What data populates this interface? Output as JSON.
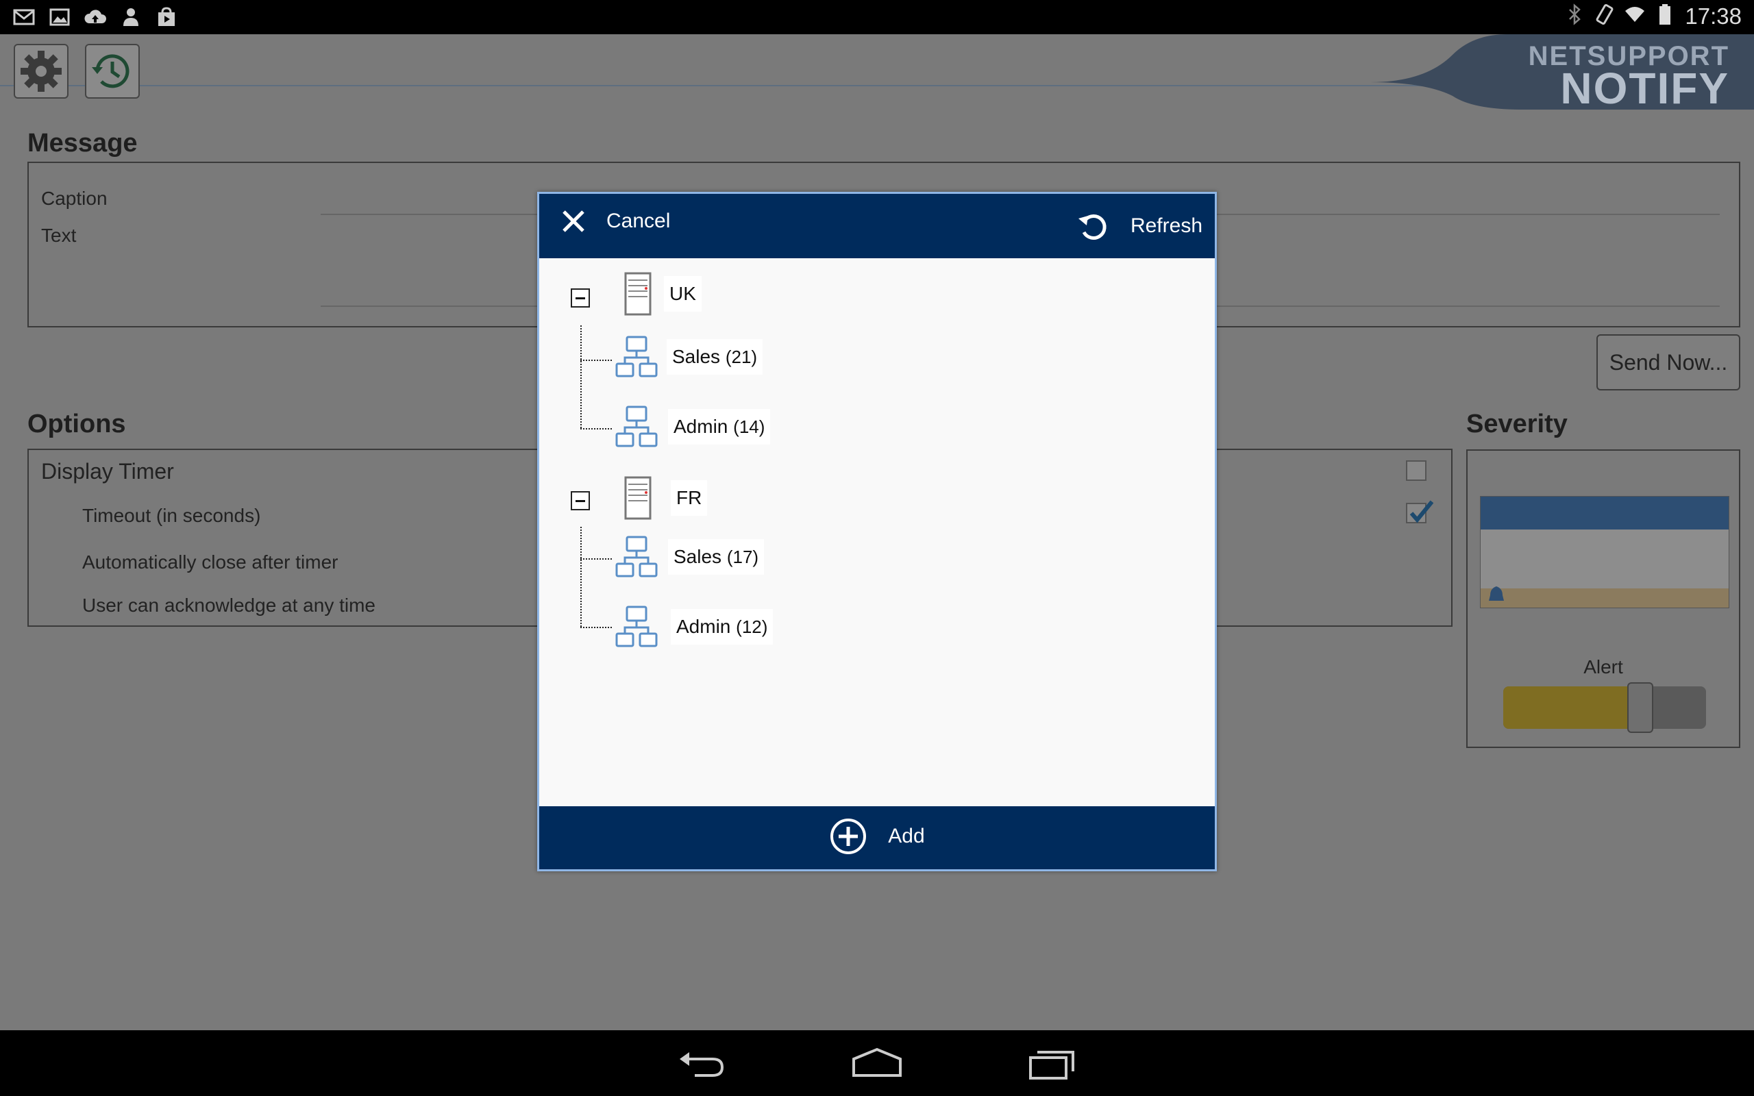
{
  "status_bar": {
    "time": "17:38",
    "left_icons": [
      "gmail-icon",
      "gallery-icon",
      "cloud-upload-icon",
      "person-icon",
      "store-bag-icon"
    ],
    "right_icons": [
      "bluetooth-icon",
      "screen-rotate-icon",
      "wifi-icon",
      "battery-icon"
    ]
  },
  "brand": {
    "line1": "NETSUPPORT",
    "line2": "NOTIFY"
  },
  "message": {
    "title": "Message",
    "caption_label": "Caption",
    "text_label": "Text"
  },
  "send_button": "Send Now...",
  "options": {
    "title": "Options",
    "display_timer": "Display Timer",
    "timeout": "Timeout (in seconds)",
    "auto_close": "Automatically close after timer",
    "user_ack": "User can acknowledge at any time",
    "display_timer_checked": false,
    "timeout_checked": true
  },
  "severity": {
    "title": "Severity",
    "level_label": "Alert",
    "level_fraction": 0.7
  },
  "dialog": {
    "cancel_label": "Cancel",
    "refresh_label": "Refresh",
    "add_label": "Add",
    "tree": [
      {
        "name": "UK",
        "expanded": true,
        "children": [
          {
            "name": "Sales",
            "count": "(21)"
          },
          {
            "name": "Admin",
            "count": "(14)"
          }
        ]
      },
      {
        "name": "FR",
        "expanded": true,
        "children": [
          {
            "name": "Sales",
            "count": "(17)"
          },
          {
            "name": "Admin",
            "count": "(12)"
          }
        ]
      }
    ]
  },
  "colors": {
    "dialog_header": "#002b5c",
    "dialog_border": "#8fb6e6",
    "severity_blue": "#2d4e73",
    "alert_yellow": "#e7c43a"
  }
}
